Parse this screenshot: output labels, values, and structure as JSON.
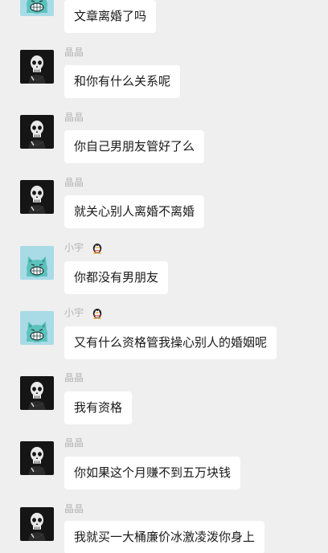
{
  "users": {
    "jingjing": {
      "name": "晶晶",
      "avatar_icon": "skull-avatar-icon"
    },
    "xiaoyu": {
      "name": "小宇",
      "avatar_icon": "blue-cat-avatar-icon",
      "badge_icon": "qq-penguin-icon"
    }
  },
  "messages": [
    {
      "sender": "xiaoyu",
      "text": "文章离婚了吗"
    },
    {
      "sender": "jingjing",
      "name": "晶晶",
      "text": "和你有什么关系呢"
    },
    {
      "sender": "jingjing",
      "name": "晶晶",
      "text": "你自己男朋友管好了么"
    },
    {
      "sender": "jingjing",
      "name": "晶晶",
      "text": "就关心别人离婚不离婚"
    },
    {
      "sender": "xiaoyu",
      "name": "小宇",
      "text": "你都没有男朋友"
    },
    {
      "sender": "xiaoyu",
      "name": "小宇",
      "text": "又有什么资格管我操心别人的婚姻呢"
    },
    {
      "sender": "jingjing",
      "name": "晶晶",
      "text": "我有资格"
    },
    {
      "sender": "jingjing",
      "name": "晶晶",
      "text": "你如果这个月赚不到五万块钱"
    },
    {
      "sender": "jingjing",
      "name": "晶晶",
      "text": "我就买一大桶廉价冰激凌泼你身上"
    }
  ]
}
